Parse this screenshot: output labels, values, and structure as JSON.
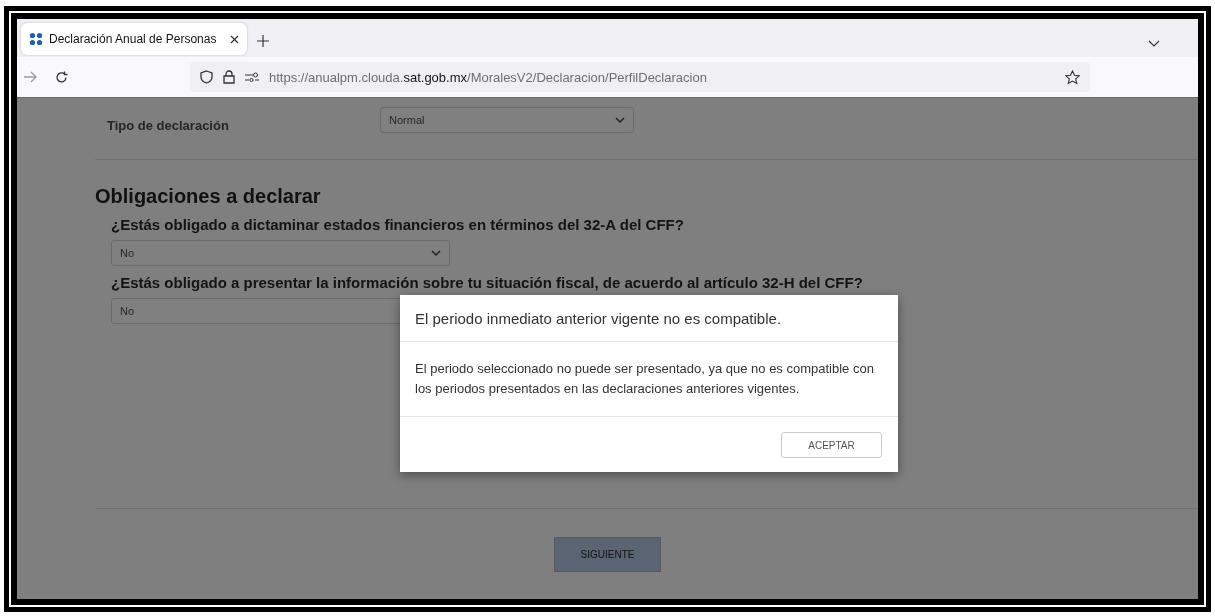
{
  "browser": {
    "tab": {
      "title": "Declaración Anual de Personas",
      "selected": true
    },
    "url": "https://anualpm.clouda.**sat.gob.mx**/MoralesV2/Declaracion/PerfilDeclaracion"
  },
  "form": {
    "tipo": {
      "label": "Tipo de declaración",
      "value": "Normal"
    },
    "section_title": "Obligaciones a declarar",
    "questions": [
      {
        "text": "¿Estás obligado a dictaminar estados financieros en términos del 32-A del CFF?",
        "value": "No",
        "arrow_visible": true
      },
      {
        "text": "¿Estás obligado a presentar la información sobre tu situación fiscal, de acuerdo al artículo 32-H del CFF?",
        "value": "No",
        "arrow_visible": false
      }
    ],
    "next_button": "SIGUIENTE"
  },
  "modal": {
    "title": "El periodo inmediato anterior vigente no es compatible.",
    "message": "El periodo seleccionado no puede ser presentado, ya que no es compatible con los periodos presentados en las declaraciones anteriores vigentes.",
    "button": "ACEPTAR"
  }
}
